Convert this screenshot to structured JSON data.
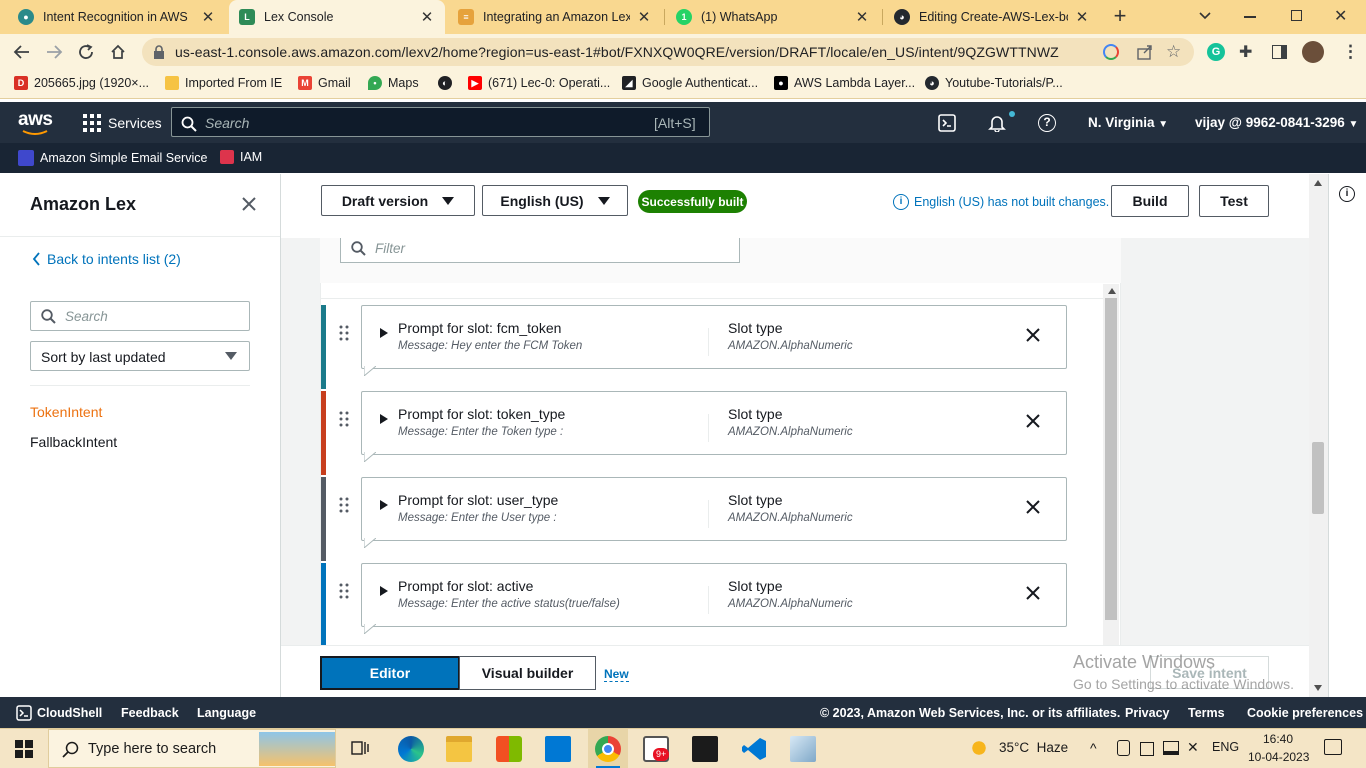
{
  "browser": {
    "tabs": [
      {
        "title": "Intent Recognition in AWS",
        "active": false
      },
      {
        "title": "Lex Console",
        "active": true
      },
      {
        "title": "Integrating an Amazon Lex B",
        "active": false
      },
      {
        "title": "(1) WhatsApp",
        "active": false
      },
      {
        "title": "Editing Create-AWS-Lex-bot",
        "active": false
      }
    ],
    "url": "us-east-1.console.aws.amazon.com/lexv2/home?region=us-east-1#bot/FXNXQW0QRE/version/DRAFT/locale/en_US/intent/9QZGWTTNWZ",
    "bookmarks": [
      "205665.jpg (1920×...",
      "Imported From IE",
      "Gmail",
      "Maps",
      "(671) Lec-0: Operati...",
      "Google Authenticat...",
      "AWS Lambda Layer...",
      "Youtube-Tutorials/P..."
    ]
  },
  "aws_nav": {
    "logo": "aws",
    "services": "Services",
    "search_placeholder": "Search",
    "search_shortcut": "[Alt+S]",
    "region": "N. Virginia",
    "account": "vijay @ 9962-0841-3296",
    "favorites": [
      "Amazon Simple Email Service",
      "IAM"
    ]
  },
  "sidebar": {
    "title": "Amazon Lex",
    "back_link": "Back to intents list (2)",
    "search_placeholder": "Search",
    "sort_label": "Sort by last updated",
    "intents": [
      {
        "name": "TokenIntent",
        "selected": true
      },
      {
        "name": "FallbackIntent",
        "selected": false
      }
    ]
  },
  "toolbar": {
    "version": "Draft version",
    "language": "English (US)",
    "build_status": "Successfully built",
    "info": "English (US) has not built changes.",
    "build": "Build",
    "test": "Test"
  },
  "filter_placeholder": "Filter",
  "slots": [
    {
      "prompt": "Prompt for slot: fcm_token",
      "message": "Message: Hey enter the FCM Token",
      "slot_type_label": "Slot type",
      "slot_type": "AMAZON.AlphaNumeric",
      "color": "#1a7a8a"
    },
    {
      "prompt": "Prompt for slot: token_type",
      "message": "Message: Enter the Token type :",
      "slot_type_label": "Slot type",
      "slot_type": "AMAZON.AlphaNumeric",
      "color": "#c73e1d"
    },
    {
      "prompt": "Prompt for slot: user_type",
      "message": "Message: Enter the User type :",
      "slot_type_label": "Slot type",
      "slot_type": "AMAZON.AlphaNumeric",
      "color": "#545b64"
    },
    {
      "prompt": "Prompt for slot: active",
      "message": "Message: Enter the active status(true/false)",
      "slot_type_label": "Slot type",
      "slot_type": "AMAZON.AlphaNumeric",
      "color": "#0073bb"
    }
  ],
  "bottom_bar": {
    "editor": "Editor",
    "visual_builder": "Visual builder",
    "new_badge": "New",
    "save_intent": "Save intent",
    "watermark_title": "Activate Windows",
    "watermark_sub": "Go to Settings to activate Windows."
  },
  "footer": {
    "cloudshell": "CloudShell",
    "feedback": "Feedback",
    "language": "Language",
    "copyright": "© 2023, Amazon Web Services, Inc. or its affiliates.",
    "privacy": "Privacy",
    "terms": "Terms",
    "cookie": "Cookie preferences"
  },
  "taskbar": {
    "search_placeholder": "Type here to search",
    "weather": "35°C  Haze",
    "lang": "ENG",
    "time": "16:40",
    "date": "10-04-2023",
    "mail_badge": "9+"
  }
}
